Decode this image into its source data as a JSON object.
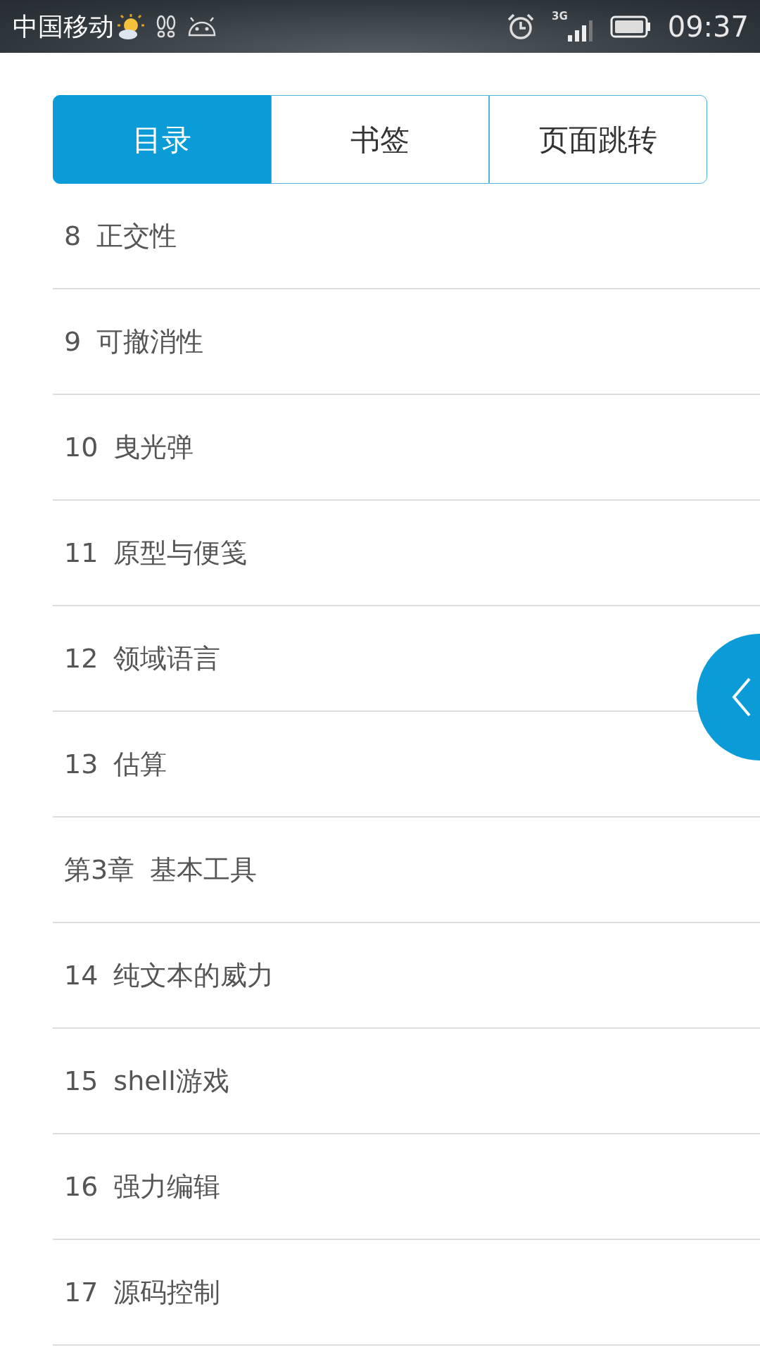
{
  "status_bar": {
    "carrier": "中国移动",
    "network": "3G",
    "time": "09:37"
  },
  "tabs": [
    {
      "label": "目录",
      "selected": true
    },
    {
      "label": "书签",
      "selected": false
    },
    {
      "label": "页面跳转",
      "selected": false
    }
  ],
  "toc": [
    {
      "number": "8",
      "title": "正交性"
    },
    {
      "number": "9",
      "title": "可撤消性"
    },
    {
      "number": "10",
      "title": "曳光弹"
    },
    {
      "number": "11",
      "title": "原型与便笺"
    },
    {
      "number": "12",
      "title": "领域语言"
    },
    {
      "number": "13",
      "title": "估算"
    },
    {
      "number": "第3章",
      "title": "基本工具"
    },
    {
      "number": "14",
      "title": "纯文本的威力"
    },
    {
      "number": "15",
      "title": "shell游戏"
    },
    {
      "number": "16",
      "title": "强力编辑"
    },
    {
      "number": "17",
      "title": "源码控制"
    }
  ]
}
